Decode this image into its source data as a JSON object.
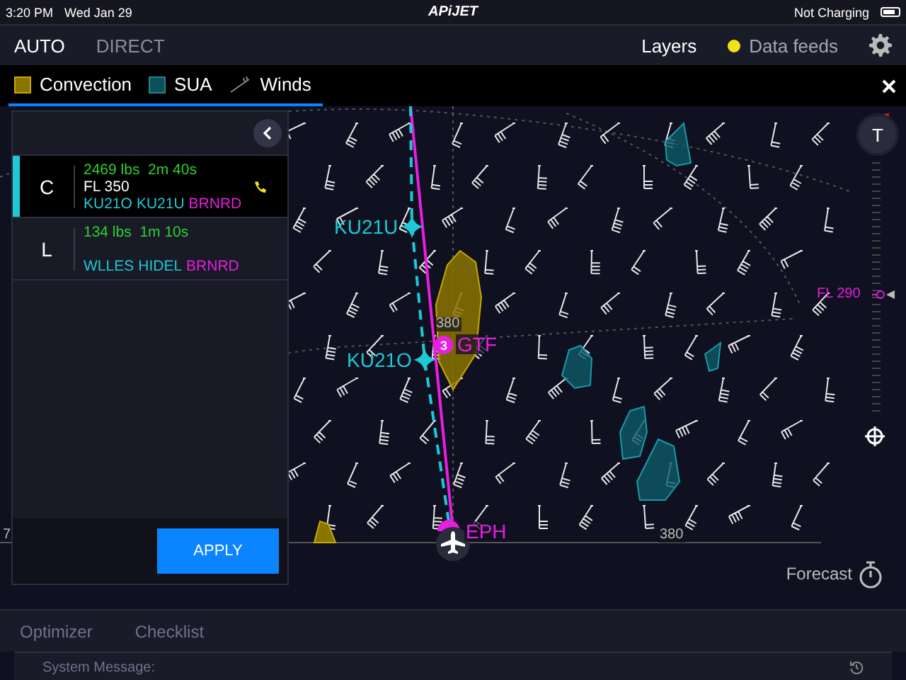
{
  "status_bar": {
    "time": "3:20 PM",
    "date": "Wed Jan 29",
    "logo": "APiJET",
    "battery_label": "Not Charging"
  },
  "mode_tabs": [
    {
      "label": "AUTO",
      "selected": true
    },
    {
      "label": "DIRECT",
      "selected": false
    }
  ],
  "header": {
    "layers": "Layers",
    "data_feeds": {
      "label": "Data feeds",
      "color": "#f2e21c"
    }
  },
  "layers": [
    {
      "label": "Convection",
      "kind": "convection",
      "selected": true
    },
    {
      "label": "SUA",
      "kind": "sua",
      "selected": true
    },
    {
      "label": "Winds",
      "kind": "winds",
      "selected": true
    }
  ],
  "panel": {
    "routes": [
      {
        "letter": "C",
        "selected": true,
        "fuel": "2469 lbs",
        "time": "2m 40s",
        "flight_level": "FL 350",
        "phone": true,
        "waypoints": [
          {
            "name": "KU21O",
            "color": "#1ec8d6"
          },
          {
            "name": "KU21U",
            "color": "#1ec8d6"
          },
          {
            "name": "BRNRD",
            "color": "#e81ee0"
          }
        ]
      },
      {
        "letter": "L",
        "selected": false,
        "fuel": "134 lbs",
        "time": "1m 10s",
        "phone": false,
        "waypoints": [
          {
            "name": "WLLES",
            "color": "#1ec8d6"
          },
          {
            "name": "HIDEL",
            "color": "#1ec8d6"
          },
          {
            "name": "BRNRD",
            "color": "#e81ee0"
          }
        ]
      }
    ],
    "apply": "APPLY"
  },
  "map": {
    "waypoints": [
      {
        "name": "KU21U",
        "kind": "fix"
      },
      {
        "name": "KU21O",
        "kind": "fix"
      },
      {
        "name": "GTF",
        "kind": "badge",
        "badge": "3"
      },
      {
        "name": "EPH",
        "kind": "endpoint"
      }
    ],
    "altitude_labels": [
      "380",
      "380"
    ],
    "edge_label": "7",
    "altitude_marker": "FL 290",
    "scale_button": "T",
    "forecast": "Forecast"
  },
  "bottom_tabs": [
    {
      "label": "Optimizer",
      "selected": false
    },
    {
      "label": "Checklist",
      "selected": false
    }
  ],
  "system_message": {
    "label": "System Message:"
  }
}
